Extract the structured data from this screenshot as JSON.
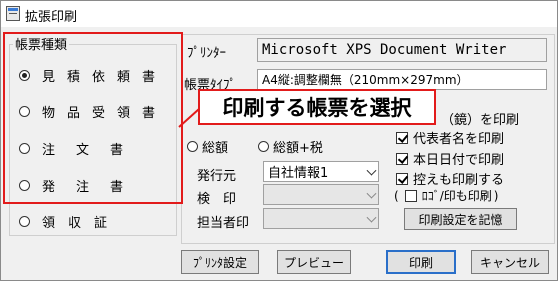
{
  "window": {
    "title": "拡張印刷"
  },
  "form_group": {
    "label": "帳票種類",
    "options": [
      {
        "label": "見積依頼書",
        "selected": true
      },
      {
        "label": "物品受領書",
        "selected": false
      },
      {
        "label": "注　文　書",
        "selected": false
      },
      {
        "label": "発　注　書",
        "selected": false
      },
      {
        "label": "領　収　証",
        "selected": false
      }
    ]
  },
  "printer": {
    "label": "ﾌﾟﾘﾝﾀｰ",
    "value": "Microsoft XPS Document Writer"
  },
  "form_type": {
    "label": "帳票ﾀｲﾌﾟ",
    "value": "A4縦:調整欄無（210mm×297mm）"
  },
  "amount_options": [
    {
      "label": "総額",
      "selected": false
    },
    {
      "label": "総額+税",
      "selected": false
    }
  ],
  "print_options": [
    {
      "label": "（鏡）を印刷",
      "checked": false
    },
    {
      "label": "代表者名を印刷",
      "checked": true
    },
    {
      "label": "本日日付で印刷",
      "checked": true
    },
    {
      "label": "控えも印刷する",
      "checked": true
    },
    {
      "label": "ﾛｺﾞ/印も印刷",
      "checked": false
    }
  ],
  "issuer": {
    "label": "発行元",
    "value": "自社情報1"
  },
  "stamp": {
    "label": "検　印",
    "value": ""
  },
  "person_stamp": {
    "label": "担当者印",
    "value": ""
  },
  "buttons": {
    "save_settings": "印刷設定を記憶",
    "printer_settings": "ﾌﾟﾘﾝﾀ設定",
    "preview": "プレビュー",
    "print": "印刷",
    "cancel": "キャンセル"
  },
  "annotation": {
    "text": "印刷する帳票を選択",
    "color": "#e21b1b"
  }
}
